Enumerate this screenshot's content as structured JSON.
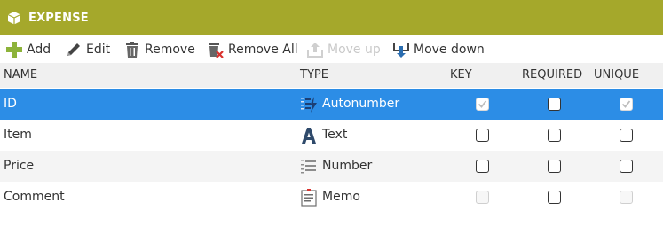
{
  "window": {
    "title": "EXPENSE"
  },
  "toolbar": {
    "add": "Add",
    "edit": "Edit",
    "remove": "Remove",
    "remove_all": "Remove All",
    "move_up": "Move up",
    "move_down": "Move down"
  },
  "columns": {
    "name": "NAME",
    "type": "TYPE",
    "key": "KEY",
    "required": "REQUIRED",
    "unique": "UNIQUE"
  },
  "rows": [
    {
      "name": "ID",
      "type": "Autonumber",
      "type_icon": "autonumber-icon",
      "key": true,
      "required": false,
      "unique": true,
      "selected": true,
      "key_enabled": false,
      "unique_enabled": false
    },
    {
      "name": "Item",
      "type": "Text",
      "type_icon": "text-type-icon",
      "key": false,
      "required": false,
      "unique": false,
      "selected": false,
      "key_enabled": true,
      "unique_enabled": true
    },
    {
      "name": "Price",
      "type": "Number",
      "type_icon": "number-type-icon",
      "key": false,
      "required": false,
      "unique": false,
      "selected": false,
      "key_enabled": true,
      "unique_enabled": true
    },
    {
      "name": "Comment",
      "type": "Memo",
      "type_icon": "memo-type-icon",
      "key": false,
      "required": false,
      "unique": false,
      "selected": false,
      "key_enabled": false,
      "unique_enabled": false
    }
  ],
  "colors": {
    "title_bar": "#a5a82b",
    "selection": "#2c8de6",
    "header_bg": "#f0f0f0",
    "add_icon": "#8db33a"
  }
}
